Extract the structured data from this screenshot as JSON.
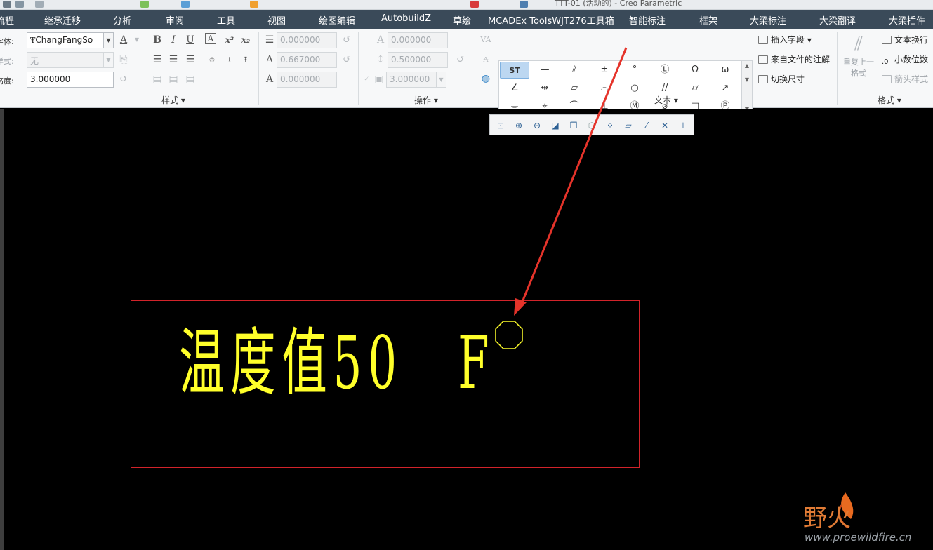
{
  "titlebar": {
    "title": "TTT-01 (活动的) - Creo Parametric"
  },
  "menu": {
    "items": [
      "流程",
      "继承迁移",
      "分析",
      "审阅",
      "工具",
      "视图",
      "绘图编辑",
      "AutobuildZ",
      "草绘",
      "MCADEx ToolsWJT276工具箱",
      "智能标注",
      "框架",
      "大梁标注",
      "大梁翻译",
      "大梁插件"
    ]
  },
  "style_group": {
    "font_label": "字体:",
    "font_value": "ChangFangSo",
    "style_label": "样式:",
    "style_value": "无",
    "height_label": "高度:",
    "height_value": "3.000000",
    "bold": "B",
    "italic": "I",
    "underline": "U",
    "frame": "A",
    "superscript": "x²",
    "subscript": "x₂",
    "group_label": "样式"
  },
  "format_fields": {
    "spacing_value": "0.000000",
    "width_value": "0.667000",
    "thickness_value": "0.000000"
  },
  "ops_group": {
    "slant_value": "0.000000",
    "line_spacing_value": "0.500000",
    "box_value": "3.000000",
    "group_label": "操作"
  },
  "symbols": {
    "rows": [
      [
        "ST",
        "—",
        "⫽",
        "±",
        "°",
        "Ⓛ",
        "Ω",
        "ω"
      ],
      [
        "∠",
        "⇹",
        "▱",
        "⌓",
        "○",
        "//",
        "⌭",
        "↗"
      ],
      [
        "⌯",
        "⌖",
        "⌒",
        "⊥",
        "Ⓜ",
        "⌀",
        "□",
        "Ⓟ"
      ]
    ],
    "insert_field": "插入字段",
    "from_file_note": "来自文件的注解",
    "toggle_dim": "切换尺寸",
    "group_label": "文本"
  },
  "format_group": {
    "repeat_last_line1": "重复上一",
    "repeat_last_line2": "格式",
    "text_wrap": "文本换行",
    "decimals": "小数位数",
    "arrow_style": "箭头样式",
    "group_label": "格式"
  },
  "drawing": {
    "note_text": "温度值50",
    "degree_symbol": "°",
    "unit": "F",
    "frame_color": "#d2232a",
    "text_color": "#ffff2a",
    "arrow_color": "#e5332a"
  },
  "watermark": {
    "url": "www.proewildfire.cn"
  }
}
